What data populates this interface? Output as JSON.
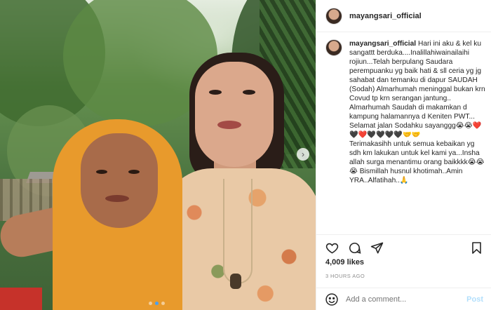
{
  "post": {
    "username": "mayangsari_official",
    "caption_user": "mayangsari_official",
    "caption_text": " Hari ini aku & kel ku sangattt berduka....Inalillahiwainailaihi rojiun...Telah berpulang Saudara perempuanku yg baik hati & sll ceria yg jg sahabat dan temanku di dapur SAUDAH (Sodah) Almarhumah meninggal bukan krn Covud tp krn serangan jantung..\nAlmarhumah Saudah di makamkan d kampung halamannya d Keniten PWT...\nSelamat jalan Sodahku sayanggg😭😭❤️🖤❤️🖤🖤🖤🖤🤝🤝\nTerimakasihh untuk semua kebaikan yg sdh km lakukan untuk kel kami ya...Insha allah surga menantimu orang baikkkk😭😭😭 Bismillah husnul khotimah..Amin YRA..Alfatihah..🙏",
    "likes": "4,009 likes",
    "time_ago": "3 HOURS AGO",
    "comment_placeholder": "Add a comment...",
    "post_label": "Post"
  },
  "carousel": {
    "next_icon": "chevron-right-icon",
    "dots": 3,
    "active_dot": 1
  },
  "icons": {
    "like": "heart-icon",
    "comment": "comment-icon",
    "share": "share-icon",
    "save": "bookmark-icon",
    "emoji": "smile-icon"
  },
  "colors": {
    "post_button": "#b2dffc",
    "hijab": "#e89a2c"
  }
}
